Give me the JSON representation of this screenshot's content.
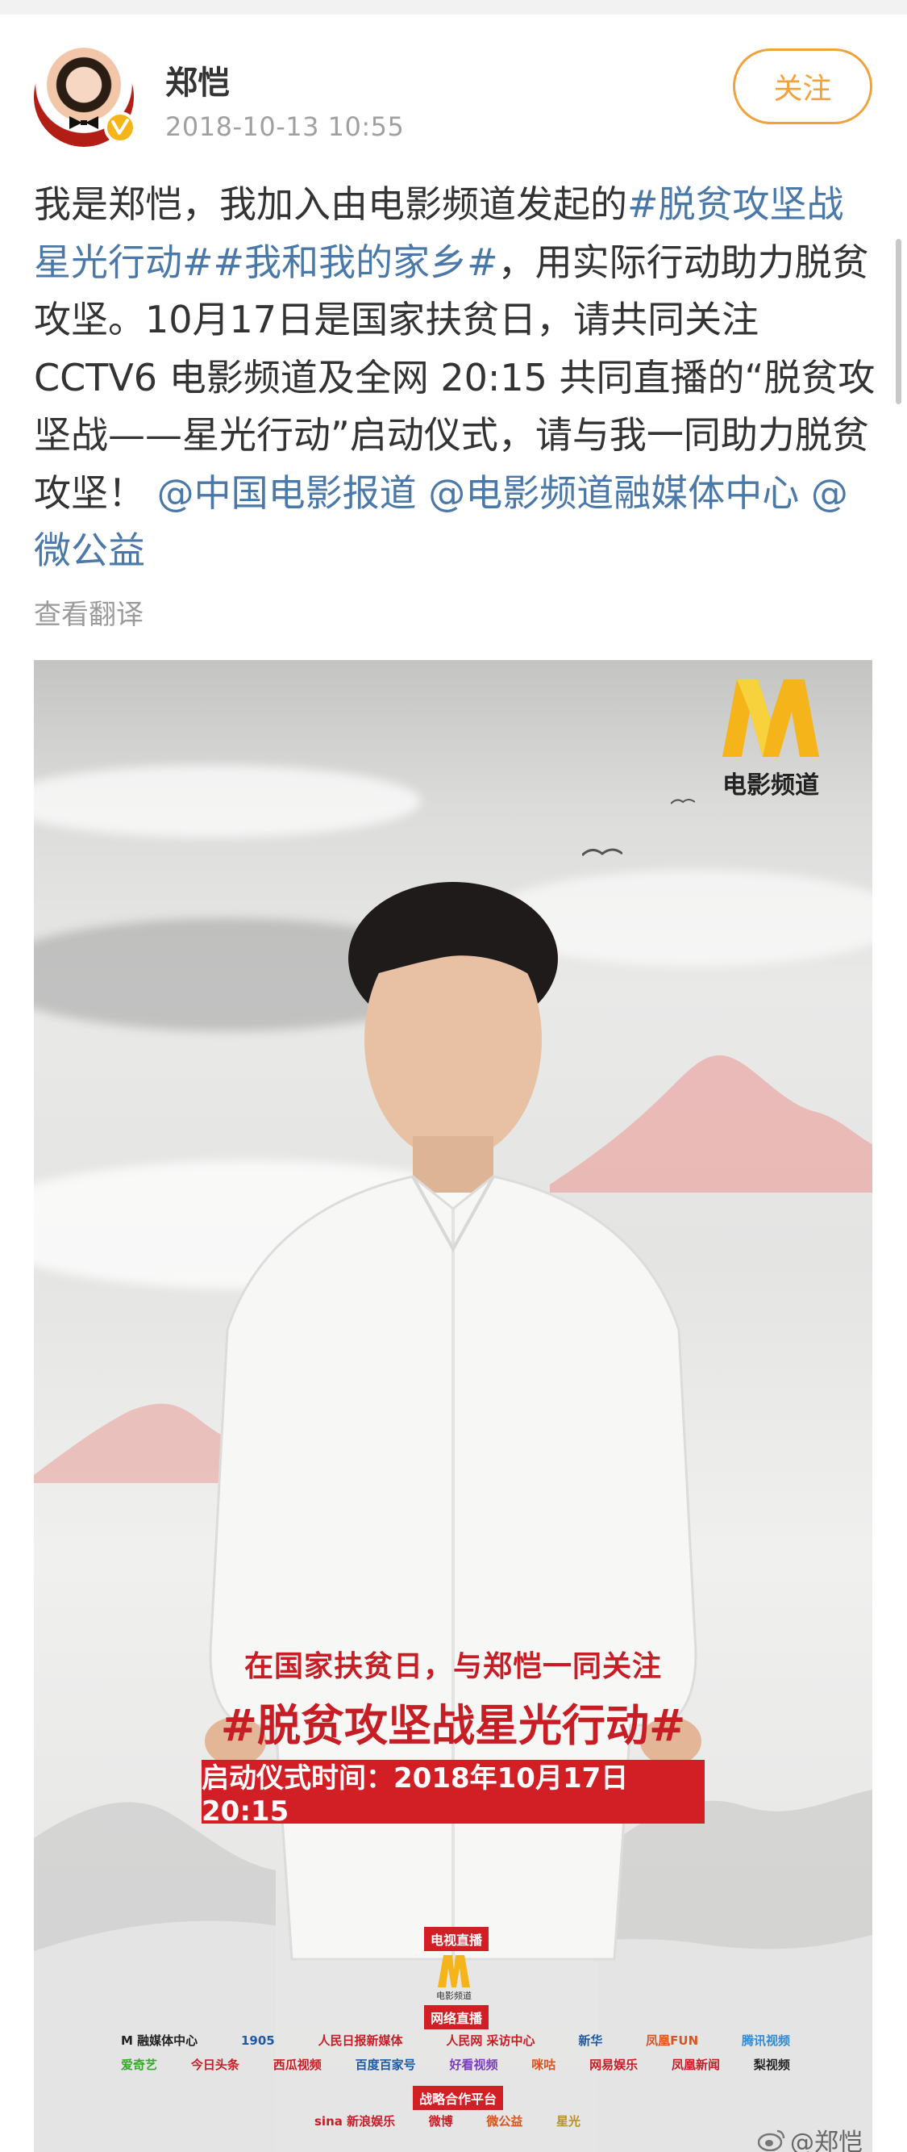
{
  "post": {
    "author": "郑恺",
    "timestamp": "2018-10-13 10:55",
    "follow_label": "关注",
    "verified_badge": "v-check-icon",
    "text": {
      "part1": "我是郑恺，我加入由电影频道发起的",
      "hashtag1": "#脱贫攻坚战星光行动#",
      "hashtag2": "#我和我的家乡#",
      "part2": "，用实际行动助力脱贫攻坚。10月17日是国家扶贫日，请共同关注 CCTV6 电影频道及全网 20:15 共同直播的“脱贫攻坚战——星光行动”启动仪式，请与我一同助力脱贫攻坚！",
      "mention1": "@中国电影报道",
      "mention2": "@电影频道融媒体中心",
      "mention3": "@微公益"
    },
    "translate_label": "查看翻译"
  },
  "poster": {
    "brand_name": "电影频道",
    "line1": "在国家扶贫日，与郑恺一同关注",
    "hashtag": "#脱贫攻坚战星光行动#",
    "time_label": "启动仪式时间：2018年10月17日20:15",
    "tv_live_label": "电视直播",
    "tv_logo_caption": "电影频道",
    "web_live_label": "网络直播",
    "strategic_label": "战略合作平台",
    "partners_row1": [
      "M 融媒体中心",
      "1905",
      "人民日报新媒体",
      "人民网 采访中心",
      "新华",
      "凤凰FUN",
      "腾讯视频"
    ],
    "partners_row2": [
      "爱奇艺",
      "今日头条",
      "西瓜视频",
      "百度百家号",
      "好看视频",
      "咪咕",
      "网易娱乐",
      "凤凰新闻",
      "梨视频"
    ],
    "partners_row3": [
      "sina 新浪娱乐",
      "微博",
      "微公益",
      "星光"
    ]
  },
  "watermark": "@郑恺",
  "colors": {
    "link": "#4a78a8",
    "follow": "#f0a23d",
    "poster_red": "#d21f26",
    "verified": "#f5b516"
  }
}
